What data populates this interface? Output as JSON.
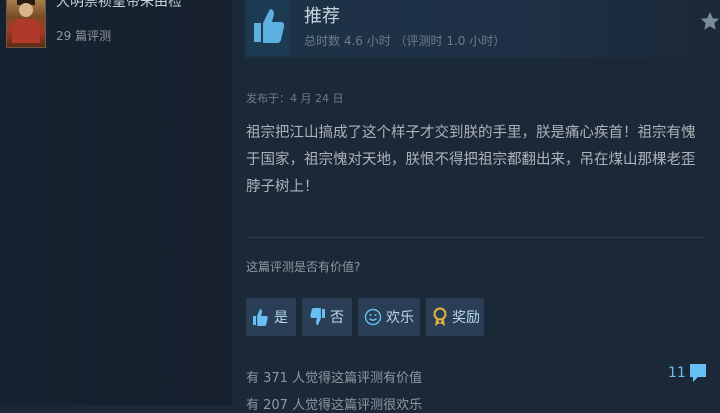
{
  "author": {
    "name": "大明崇祯皇帝朱由检",
    "reviews_count": "29 篇评测"
  },
  "recommendation": {
    "title": "推荐",
    "hours": "总时数 4.6 小时  （评测时 1.0 小时）"
  },
  "review": {
    "posted": "发布于：4 月 24 日",
    "text": "祖宗把江山搞成了这个样子才交到朕的手里，朕是痛心疾首！祖宗有愧于国家，祖宗愧对天地，朕恨不得把祖宗都翻出来，吊在煤山那棵老歪脖子树上！"
  },
  "feedback": {
    "question": "这篇评测是否有价值?",
    "yes_label": "是",
    "no_label": "否",
    "funny_label": "欢乐",
    "award_label": "奖励",
    "helpful_count": "有 371 人觉得这篇评测有价值",
    "funny_count": "有 207 人觉得这篇评测很欢乐",
    "comments": "11"
  },
  "colors": {
    "background": "#1b2838",
    "accent": "#66c0f4",
    "button": "#2a3f55"
  }
}
